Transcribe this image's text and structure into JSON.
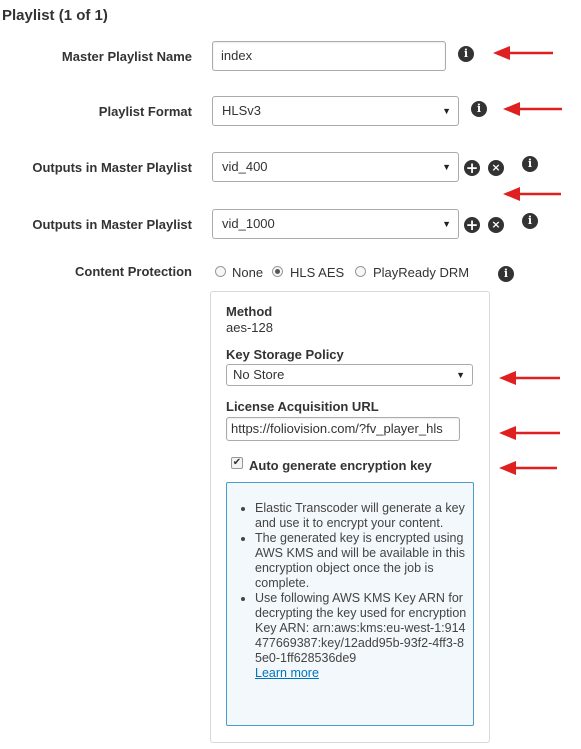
{
  "section": {
    "title": "Playlist (1 of 1)"
  },
  "fields": {
    "master_name_label": "Master Playlist Name",
    "master_name_value": "index",
    "format_label": "Playlist Format",
    "format_value": "HLSv3",
    "outputs_label_1": "Outputs in Master Playlist",
    "outputs_value_1": "vid_400",
    "outputs_label_2": "Outputs in Master Playlist",
    "outputs_value_2": "vid_1000",
    "protection_label": "Content Protection"
  },
  "protection_options": [
    "None",
    "HLS AES",
    "PlayReady DRM"
  ],
  "protection_selected": "HLS AES",
  "panel": {
    "method_label": "Method",
    "method_value": "aes-128",
    "key_storage_label": "Key Storage Policy",
    "key_storage_value": "No Store",
    "license_label": "License Acquisition URL",
    "license_value": "https://foliovision.com/?fv_player_hls",
    "auto_gen_label": "Auto generate encryption key",
    "auto_gen_checked": true
  },
  "infobox": {
    "item1": "Elastic Transcoder will generate a key and use it to encrypt your content.",
    "item2": "The generated key is encrypted using AWS KMS and will be available in this encryption object once the job is complete.",
    "item3": "Use following AWS KMS Key ARN for decrypting the key used for encryption",
    "arn": "Key ARN: arn:aws:kms:eu-west-1:914477669387:key/12add95b-93f2-4ff3-85e0-1ff628536de9",
    "learn_more": "Learn more"
  },
  "icons": {
    "info": "i",
    "plus": "+",
    "remove": "×",
    "dropdown": "▼",
    "check": "✔"
  },
  "colors": {
    "annotation_arrow": "#e02020",
    "info_border": "#4a9cc8",
    "link": "#0073bb"
  }
}
